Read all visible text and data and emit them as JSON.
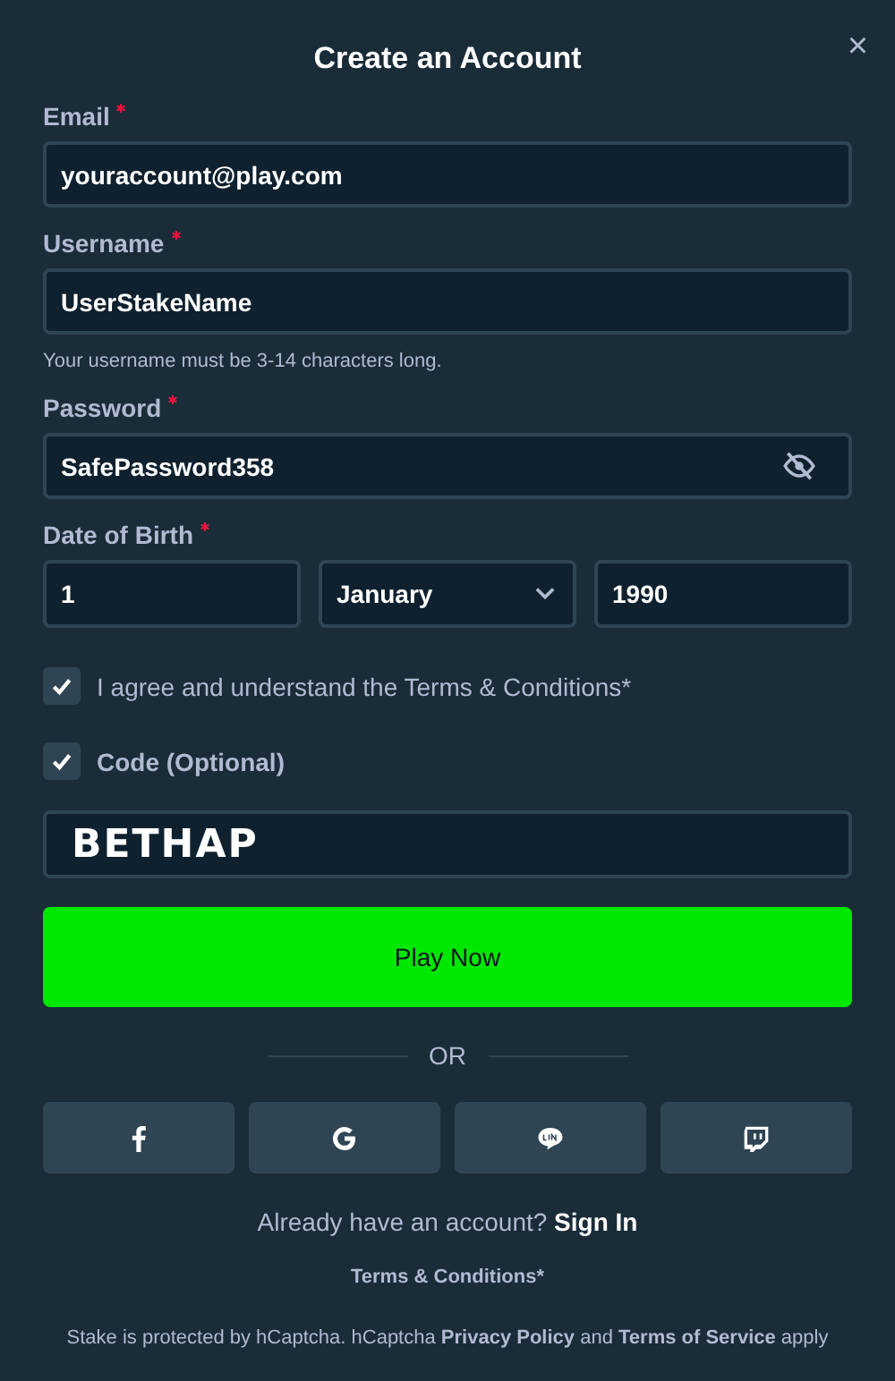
{
  "dialog": {
    "title": "Create an Account",
    "close": "×"
  },
  "fields": [
    {
      "label": "Email",
      "required": true,
      "value": "youraccount@play.com"
    },
    {
      "label": "Username",
      "required": true,
      "value": "UserStakeName",
      "hint": "Your username must be 3-14 characters long."
    },
    {
      "label": "Password",
      "required": true,
      "value": "SafePassword358",
      "kind": "password",
      "visible": true
    }
  ],
  "birth": {
    "label": "Date of Birth",
    "required": true,
    "parts": [
      {
        "kind": "text",
        "value": "1"
      },
      {
        "kind": "select",
        "value": "January"
      },
      {
        "kind": "text",
        "value": "1990"
      }
    ]
  },
  "terms_checkbox": {
    "label": "I agree and understand the Terms & Conditions*",
    "checked": true
  },
  "code_checkbox": {
    "label": "Code (Optional)",
    "checked": true
  },
  "code_field": {
    "value": "BETHAP"
  },
  "submit": "Play Now",
  "divider": "OR",
  "social": [
    {
      "kind": "facebook"
    },
    {
      "kind": "google"
    },
    {
      "kind": "line"
    },
    {
      "kind": "twitch"
    }
  ],
  "sign_in": {
    "text": "Already have an account?",
    "link": "Sign In"
  },
  "terms_link": "Terms & Conditions*",
  "notice": [
    {
      "kind": "text",
      "text": "Stake is protected by hCaptcha. hCaptcha"
    },
    {
      "kind": "link",
      "text": "Privacy Policy"
    },
    {
      "kind": "text",
      "text": "and"
    },
    {
      "kind": "link",
      "text": "Terms of Service"
    },
    {
      "kind": "text",
      "text": "apply"
    }
  ]
}
